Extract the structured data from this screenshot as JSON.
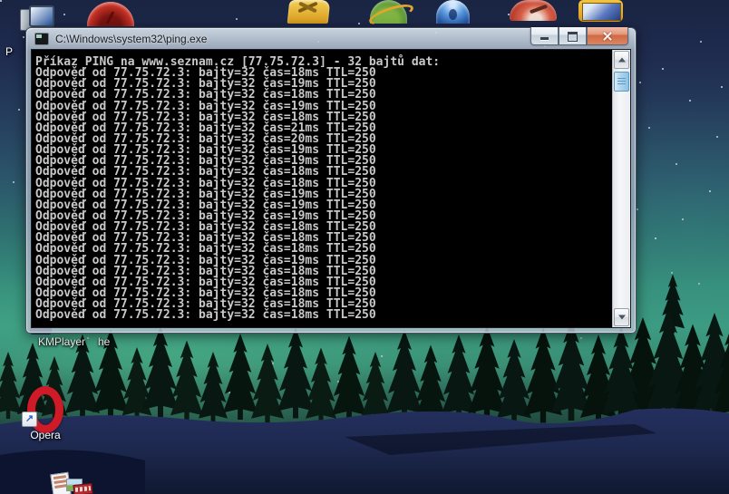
{
  "window": {
    "title": "C:\\Windows\\system32\\ping.exe"
  },
  "console": {
    "lines": [
      "Příkaz PING na www.seznam.cz [77.75.72.3] - 32 bajtů dat:",
      "Odpověď od 77.75.72.3: bajty=32 čas=18ms TTL=250",
      "Odpověď od 77.75.72.3: bajty=32 čas=19ms TTL=250",
      "Odpověď od 77.75.72.3: bajty=32 čas=18ms TTL=250",
      "Odpověď od 77.75.72.3: bajty=32 čas=19ms TTL=250",
      "Odpověď od 77.75.72.3: bajty=32 čas=18ms TTL=250",
      "Odpověď od 77.75.72.3: bajty=32 čas=21ms TTL=250",
      "Odpověď od 77.75.72.3: bajty=32 čas=20ms TTL=250",
      "Odpověď od 77.75.72.3: bajty=32 čas=19ms TTL=250",
      "Odpověď od 77.75.72.3: bajty=32 čas=19ms TTL=250",
      "Odpověď od 77.75.72.3: bajty=32 čas=18ms TTL=250",
      "Odpověď od 77.75.72.3: bajty=32 čas=18ms TTL=250",
      "Odpověď od 77.75.72.3: bajty=32 čas=19ms TTL=250",
      "Odpověď od 77.75.72.3: bajty=32 čas=19ms TTL=250",
      "Odpověď od 77.75.72.3: bajty=32 čas=19ms TTL=250",
      "Odpověď od 77.75.72.3: bajty=32 čas=18ms TTL=250",
      "Odpověď od 77.75.72.3: bajty=32 čas=18ms TTL=250",
      "Odpověď od 77.75.72.3: bajty=32 čas=18ms TTL=250",
      "Odpověď od 77.75.72.3: bajty=32 čas=19ms TTL=250",
      "Odpověď od 77.75.72.3: bajty=32 čas=18ms TTL=250",
      "Odpověď od 77.75.72.3: bajty=32 čas=18ms TTL=250",
      "Odpověď od 77.75.72.3: bajty=32 čas=18ms TTL=250",
      "Odpověď od 77.75.72.3: bajty=32 čas=18ms TTL=250",
      "Odpověď od 77.75.72.3: bajty=32 čas=18ms TTL=250"
    ]
  },
  "desktop": {
    "icon_labels": {
      "kmplayer": "KMPlayer",
      "partial_he": "he",
      "opera": "Opera",
      "partial_p": "P"
    },
    "top_icon_names": [
      "computer-icon",
      "red-media-player-icon",
      "toolbox-icon",
      "globe-icon",
      "blue-orb-icon",
      "red-disc-icon",
      "monitor-icon"
    ],
    "other_icon_names": [
      "shortcut-arrow-icon",
      "documents-media-icon",
      "kmplayer-icon-fragment"
    ]
  },
  "colors": {
    "console_bg": "#000000",
    "console_text": "#c9c9c9",
    "titlebar_text": "#1c1c1c",
    "close_button": "#cf6a45",
    "scroll_thumb": "#a9d2ec",
    "aurora_green": "#3c9c82",
    "sky_blue": "#1a2443",
    "snow_navy": "#232f60",
    "opera_red": "#cf1a28"
  }
}
